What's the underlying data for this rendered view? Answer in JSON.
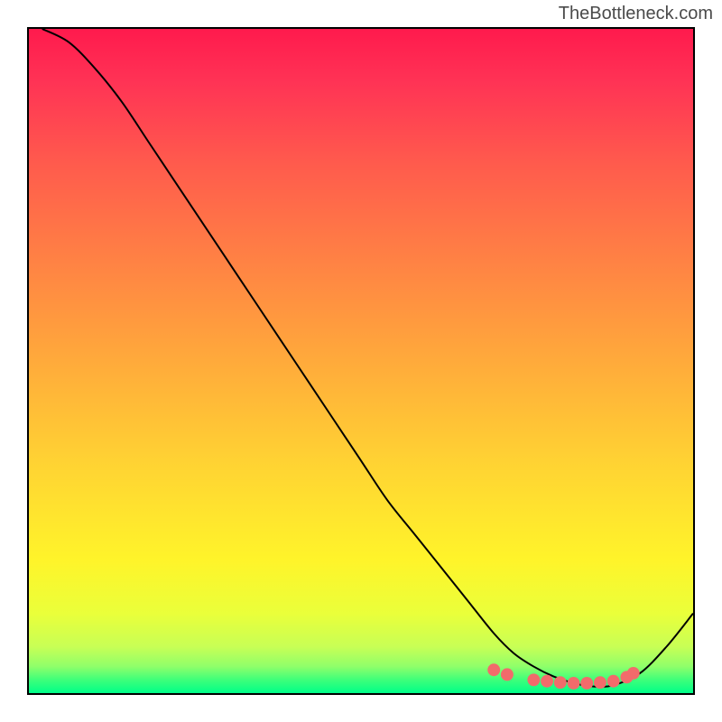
{
  "watermark": "TheBottleneck.com",
  "chart_data": {
    "type": "line",
    "title": "",
    "xlabel": "",
    "ylabel": "",
    "xlim": [
      0,
      100
    ],
    "ylim": [
      0,
      100
    ],
    "series": [
      {
        "name": "curve",
        "x": [
          2,
          6,
          10,
          14,
          18,
          22,
          26,
          30,
          34,
          38,
          42,
          46,
          50,
          54,
          58,
          62,
          66,
          70,
          73,
          76,
          79,
          82,
          85,
          88,
          92,
          96,
          100
        ],
        "y": [
          100,
          98,
          94,
          89,
          83,
          77,
          71,
          65,
          59,
          53,
          47,
          41,
          35,
          29,
          24,
          19,
          14,
          9,
          6,
          4,
          2.5,
          1.5,
          1,
          1.2,
          3,
          7,
          12
        ]
      }
    ],
    "markers": {
      "x": [
        70,
        72,
        76,
        78,
        80,
        82,
        84,
        86,
        88,
        90,
        91
      ],
      "y": [
        3.5,
        2.8,
        2.0,
        1.8,
        1.6,
        1.5,
        1.5,
        1.6,
        1.8,
        2.4,
        3.0
      ],
      "color": "#f26b6b",
      "radius": 7
    },
    "curve_color": "#000000",
    "curve_width": 2
  }
}
